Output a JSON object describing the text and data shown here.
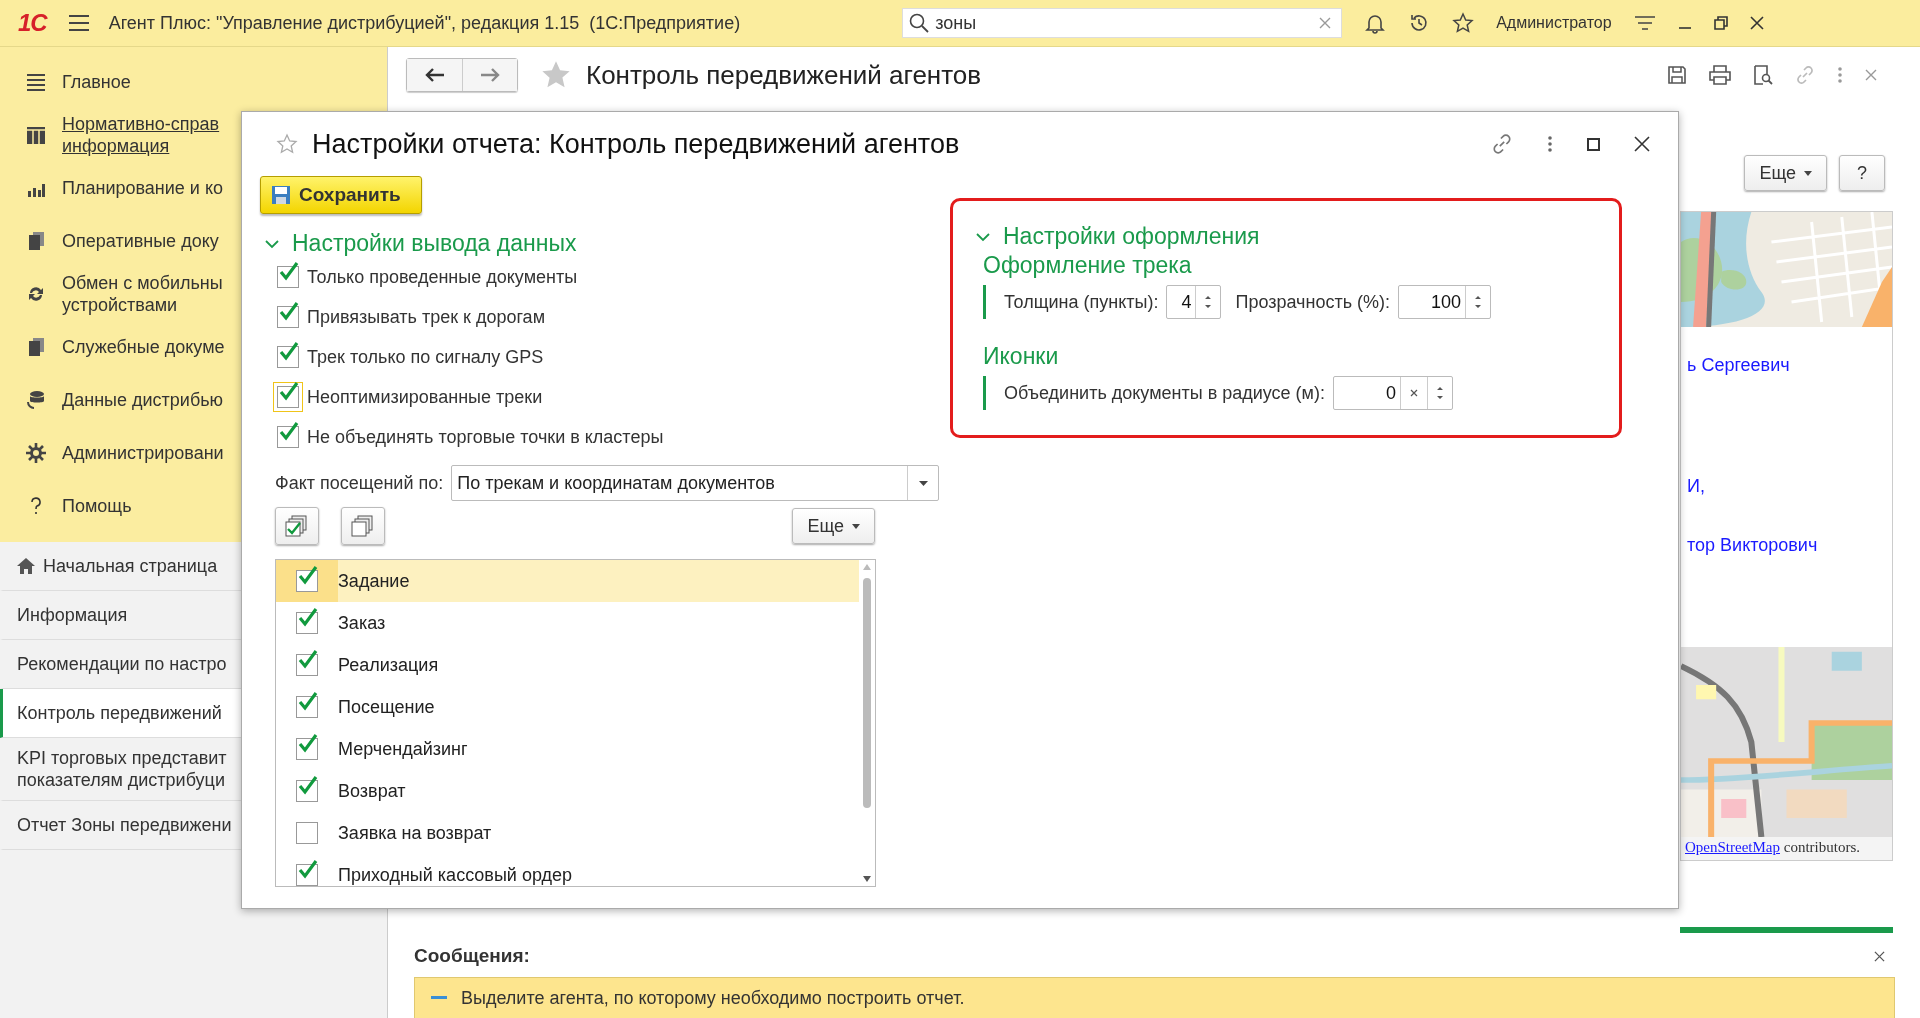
{
  "app_bar": {
    "logo": "1С",
    "title": "Агент Плюс: \"Управление дистрибуцией\", редакция 1.15  (1С:Предприятие)",
    "search": {
      "value": "зоны"
    },
    "user": "Администратор"
  },
  "sidebar": {
    "sections": [
      {
        "label": "Главное",
        "selected": false
      },
      {
        "label": "Нормативно-справ\nинформация",
        "selected": true
      },
      {
        "label": "Планирование и ко",
        "selected": false
      },
      {
        "label": "Оперативные доку",
        "selected": false
      },
      {
        "label": "Обмен с мобильны\nустройствами",
        "selected": false
      },
      {
        "label": "Служебные докуме",
        "selected": false
      },
      {
        "label": "Данные дистрибью",
        "selected": false
      },
      {
        "label": "Администрировани",
        "selected": false
      },
      {
        "label": "Помощь",
        "selected": false
      }
    ],
    "open_pages": [
      {
        "label": "Начальная страница",
        "kind": "home",
        "selected": false
      },
      {
        "label": "Информация",
        "kind": "page",
        "selected": false
      },
      {
        "label": "Рекомендации по настро",
        "kind": "page",
        "selected": false
      },
      {
        "label": "Контроль передвижений",
        "kind": "page",
        "selected": true
      },
      {
        "label": "KPI торговых представит\nпоказателям дистрибуци",
        "kind": "page",
        "selected": false
      },
      {
        "label": "Отчет Зоны передвижени",
        "kind": "page",
        "selected": false
      }
    ]
  },
  "page": {
    "title": "Контроль передвижений агентов",
    "more_button": "Еще",
    "help_button": "?",
    "agents": [
      "ь Сергеевич",
      "И,",
      "тор Викторович"
    ],
    "map_credit": {
      "link": "OpenStreetMap",
      "text": "contributors."
    }
  },
  "messages": {
    "title": "Сообщения:",
    "items": [
      "Выделите агента, по которому необходимо построить отчет."
    ]
  },
  "dialog": {
    "title": "Настройки отчета: Контроль передвижений агентов",
    "save_button": "Сохранить",
    "output_section": {
      "title": "Настройки вывода данных",
      "expanded": true,
      "options": [
        {
          "label": "Только проведенные документы",
          "checked": true,
          "focused": false
        },
        {
          "label": "Привязывать трек к дорогам",
          "checked": true,
          "focused": false
        },
        {
          "label": "Трек только по сигналу GPS",
          "checked": true,
          "focused": false
        },
        {
          "label": "Неоптимизированные треки",
          "checked": true,
          "focused": true
        },
        {
          "label": "Не объединять торговые точки в кластеры",
          "checked": true,
          "focused": false
        }
      ],
      "visit_fact": {
        "label": "Факт посещений по:",
        "value": "По трекам и координатам документов"
      },
      "more_button": "Еще",
      "documents": [
        {
          "label": "Задание",
          "checked": true,
          "selected": true
        },
        {
          "label": "Заказ",
          "checked": true,
          "selected": false
        },
        {
          "label": "Реализация",
          "checked": true,
          "selected": false
        },
        {
          "label": "Посещение",
          "checked": true,
          "selected": false
        },
        {
          "label": "Мерчендайзинг",
          "checked": true,
          "selected": false
        },
        {
          "label": "Возврат",
          "checked": true,
          "selected": false
        },
        {
          "label": "Заявка на возврат",
          "checked": false,
          "selected": false
        },
        {
          "label": "Приходный кассовый ордер",
          "checked": true,
          "selected": false
        }
      ]
    },
    "appearance_section": {
      "title": "Настройки оформления",
      "expanded": true,
      "highlighted": true,
      "groups": [
        {
          "title": "Оформление трека",
          "fields": [
            {
              "label": "Толщина (пункты):",
              "value": "4",
              "clearable": false
            },
            {
              "label": "Прозрачность (%):",
              "value": "100",
              "clearable": false
            }
          ]
        },
        {
          "title": "Иконки",
          "fields": [
            {
              "label": "Объединить документы в радиусе (м):",
              "value": "0",
              "clearable": true
            }
          ]
        }
      ]
    }
  }
}
